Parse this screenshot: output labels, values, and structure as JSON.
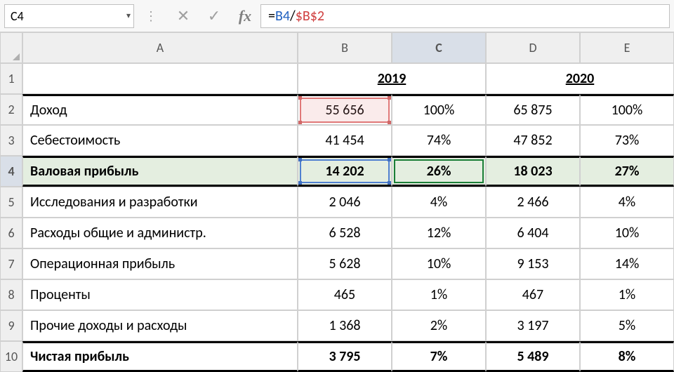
{
  "formula_bar": {
    "cell_reference": "C4",
    "tok_eq": "=",
    "tok_ref1": "B4",
    "tok_op": "/",
    "tok_ref2": "$B$2"
  },
  "cancel_glyph": "✕",
  "accept_glyph": "✓",
  "fx_glyph": "fx",
  "dots_glyph": "⋮",
  "dropdown_glyph": "▾",
  "col": {
    "A": "A",
    "B": "B",
    "C": "C",
    "D": "D",
    "E": "E"
  },
  "rownum": {
    "1": "1",
    "2": "2",
    "3": "3",
    "4": "4",
    "5": "5",
    "6": "6",
    "7": "7",
    "8": "8",
    "9": "9",
    "10": "10"
  },
  "year": {
    "y2019": "2019",
    "y2020": "2020"
  },
  "rows": {
    "r2": {
      "label": "Доход",
      "b": "55 656",
      "c": "100%",
      "d": "65 875",
      "e": "100%"
    },
    "r3": {
      "label": "Себестоимость",
      "b": "41 454",
      "c": "74%",
      "d": "47 852",
      "e": "73%"
    },
    "r4": {
      "label": "Валовая прибыль",
      "b": "14 202",
      "c": "26%",
      "d": "18 023",
      "e": "27%"
    },
    "r5": {
      "label": "Исследования и разработки",
      "b": "2 046",
      "c": "4%",
      "d": "2 466",
      "e": "4%"
    },
    "r6": {
      "label": "Расходы общие и администр.",
      "b": "6 528",
      "c": "12%",
      "d": "6 404",
      "e": "10%"
    },
    "r7": {
      "label": "Операционная прибыль",
      "b": "5 628",
      "c": "10%",
      "d": "9 153",
      "e": "14%"
    },
    "r8": {
      "label": "Проценты",
      "b": "465",
      "c": "1%",
      "d": "467",
      "e": "1%"
    },
    "r9": {
      "label": "Прочие доходы и расходы",
      "b": "1 368",
      "c": "2%",
      "d": "3 197",
      "e": "5%"
    },
    "r10": {
      "label": "Чистая прибыль",
      "b": "3 795",
      "c": "7%",
      "d": "5 489",
      "e": "8%"
    }
  }
}
